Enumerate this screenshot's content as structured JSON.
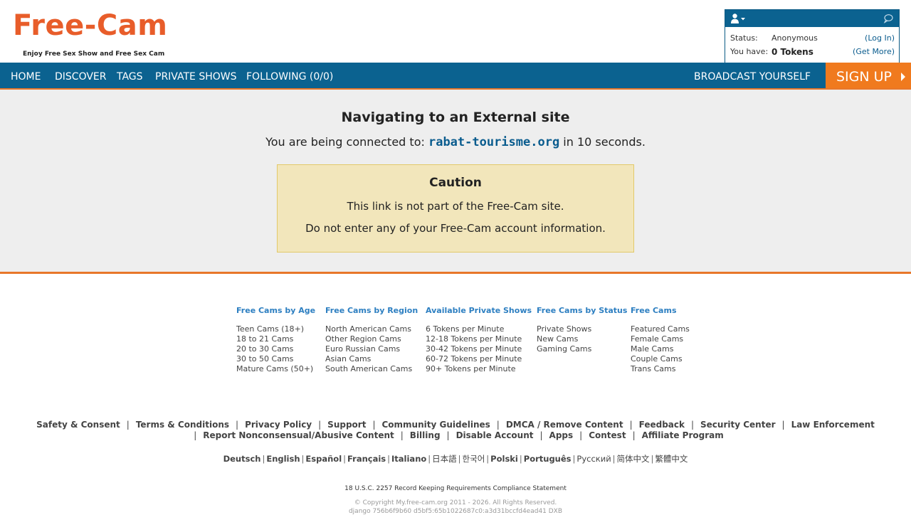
{
  "header": {
    "logo": "Free-Cam",
    "tagline": "Enjoy Free Sex Show and Free Sex Cam",
    "status_label": "Status:",
    "status_value": "Anonymous",
    "login_link": "(Log In)",
    "have_label": "You have:",
    "tokens_value": "0 Tokens",
    "get_more_link": "(Get More)"
  },
  "nav": {
    "items": [
      "HOME",
      "DISCOVER",
      "TAGS",
      "PRIVATE SHOWS",
      "FOLLOWING (0/0)"
    ],
    "broadcast": "BROADCAST YOURSELF",
    "signup": "SIGN UP"
  },
  "main": {
    "title": "Navigating to an External site",
    "connect_prefix": "You are being connected to:",
    "domain": "rabat-tourisme.org",
    "connect_suffix": "in 10 seconds.",
    "caution_title": "Caution",
    "caution_line1": "This link is not part of the Free-Cam site.",
    "caution_line2": "Do not enter any of your Free-Cam account information."
  },
  "footer_columns": [
    {
      "title": "Free Cams by Age",
      "items": [
        "Teen Cams (18+)",
        "18 to 21 Cams",
        "20 to 30 Cams",
        "30 to 50 Cams",
        "Mature Cams (50+)"
      ]
    },
    {
      "title": "Free Cams by Region",
      "items": [
        "North American Cams",
        "Other Region Cams",
        "Euro Russian Cams",
        "Asian Cams",
        "South American Cams"
      ]
    },
    {
      "title": "Available Private Shows",
      "items": [
        "6 Tokens per Minute",
        "12-18 Tokens per Minute",
        "30-42 Tokens per Minute",
        "60-72 Tokens per Minute",
        "90+ Tokens per Minute"
      ]
    },
    {
      "title": "Free Cams by Status",
      "items": [
        "Private Shows",
        "New Cams",
        "Gaming Cams"
      ]
    },
    {
      "title": "Free Cams",
      "items": [
        "Featured Cams",
        "Female Cams",
        "Male Cams",
        "Couple Cams",
        "Trans Cams"
      ]
    }
  ],
  "footer_links_row1": [
    "Safety & Consent",
    "Terms & Conditions",
    "Privacy Policy",
    "Support",
    "Community Guidelines",
    "DMCA / Remove Content",
    "Feedback",
    "Security Center",
    "Law Enforcement"
  ],
  "footer_links_row2": [
    "Report Nonconsensual/Abusive Content",
    "Billing",
    "Disable Account",
    "Apps",
    "Contest",
    "Affiliate Program"
  ],
  "languages": [
    "Deutsch",
    "English",
    "Español",
    "Français",
    "Italiano",
    "日本語",
    "한국어",
    "Polski",
    "Português",
    "Русский",
    "简体中文",
    "繁體中文"
  ],
  "compliance": "18 U.S.C. 2257 Record Keeping Requirements Compliance Statement",
  "copyright": "© Copyright My.free-cam.org 2011 - 2026. All Rights Reserved.",
  "build_info": "django 756b6f9b60 d5bf5:65b1022687c0:a3d31bccfd4ead41 DXB"
}
